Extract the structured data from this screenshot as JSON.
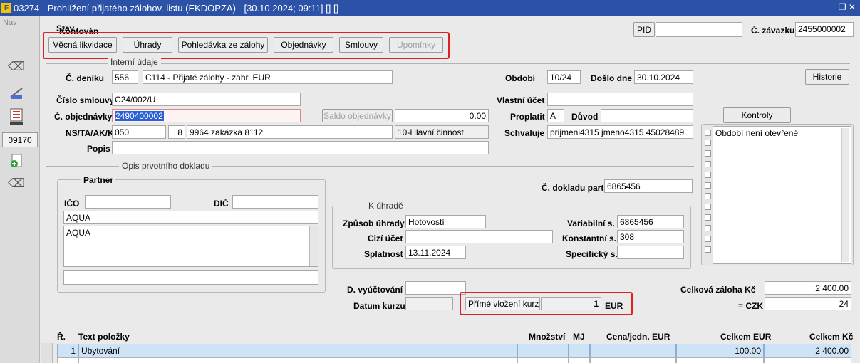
{
  "window": {
    "title": "03274 - Prohlížení přijatého zálohov. listu (EKDOPZA) - [30.10.2024; 09:11] [] []",
    "controls": "❐ ✕"
  },
  "sidebar": {
    "nav_label": "Nav",
    "code": "09170"
  },
  "header": {
    "stav_label": "Stav",
    "stav_value": "Kontován",
    "pid_button": "PID",
    "pid_value": "",
    "zavazek_label": "Č. závazku",
    "zavazek_value": "2455000002"
  },
  "toolbar": {
    "vecna": "Věcná likvidace",
    "uhrady": "Úhrady",
    "pohledavka": "Pohledávka ze zálohy",
    "objednavky": "Objednávky",
    "smlouvy": "Smlouvy",
    "upominky": "Upomínky"
  },
  "interni": {
    "section": "Interní údaje",
    "denik_label": "Č. deníku",
    "denik_code": "556",
    "denik_name": "C114 - Přijaté zálohy - zahr. EUR",
    "obdobi_label": "Období",
    "obdobi_value": "10/24",
    "doslo_label": "Došlo dne",
    "doslo_value": "30.10.2024",
    "historie_button": "Historie",
    "smlouva_label": "Číslo smlouvy",
    "smlouva_value": "C24/002/U",
    "vlastni_label": "Vlastní účet",
    "vlastni_value": "",
    "objednavka_label": "Č. objednávky",
    "objednavka_value": "2490400002",
    "saldo_button": "Saldo objednávky",
    "saldo_value": "0.00",
    "proplatit_label": "Proplatit",
    "proplatit_value": "A",
    "duvod_label": "Důvod",
    "duvod_value": "",
    "ns_label": "NS/TA/AK/KP",
    "ns_value": "050",
    "ta_value": "8",
    "ak_value": "9964 zakázka 8112",
    "kp_value": "10-Hlavní činnost",
    "schvaluje_label": "Schvaluje",
    "schvaluje_value": "prijmeni4315 jmeno4315 45028489",
    "popis_label": "Popis",
    "popis_value": ""
  },
  "kontroly": {
    "button": "Kontroly",
    "item1": "Období není otevřené"
  },
  "opis": {
    "section": "Opis prvotního dokladu",
    "partner_section": "Partner",
    "ico_label": "IČO",
    "ico_value": "",
    "dic_label": "DIČ",
    "dic_value": "",
    "name_value": "AQUA",
    "address_value": "AQUA",
    "extra_value": "",
    "doklad_label": "Č. dokladu part.",
    "doklad_value": "6865456"
  },
  "kuhrade": {
    "section": "K úhradě",
    "zpusob_label": "Způsob úhrady",
    "zpusob_value": "Hotovostí",
    "cizi_label": "Cizí účet",
    "cizi_value": "",
    "splatnost_label": "Splatnost",
    "splatnost_value": "13.11.2024",
    "variabilni_label": "Variabilní s.",
    "variabilni_value": "6865456",
    "konstantni_label": "Konstantní s.",
    "konstantni_value": "308",
    "specificky_label": "Specifický s.",
    "specificky_value": ""
  },
  "kurz": {
    "vyuctovani_label": "D. vyúčtování",
    "vyuctovani_value": "",
    "datum_label": "Datum kurzu",
    "datum_value": "",
    "prime_label": "Přímé vložení kurzu",
    "kurz_value": "1",
    "currency": "EUR"
  },
  "totals": {
    "zaloha_label": "Celková záloha Kč",
    "zaloha_value": "2 400.00",
    "czk_label": "= CZK",
    "czk_value": "24"
  },
  "table": {
    "headers": {
      "r": "Ř.",
      "text": "Text položky",
      "mnozstvi": "Množství",
      "mj": "MJ",
      "cena": "Cena/jedn.",
      "cena_cur": "EUR",
      "celkem": "Celkem",
      "celkem_cur": "EUR",
      "celkem_kc": "Celkem Kč"
    },
    "rows": [
      {
        "r": "1",
        "text": "Ubytování",
        "mnozstvi": "",
        "mj": "",
        "cena": "",
        "celkem": "100.00",
        "celkem_kc": "2 400.00"
      }
    ]
  }
}
